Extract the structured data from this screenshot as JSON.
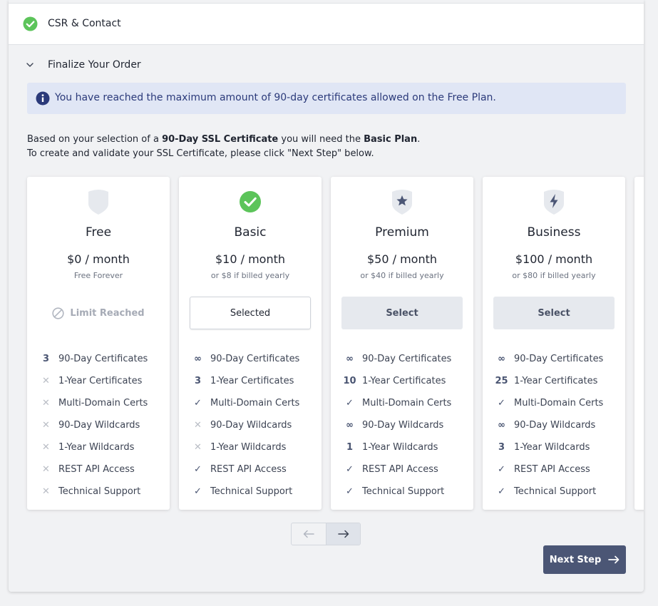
{
  "steps": {
    "csr_label": "CSR & Contact",
    "finalize_label": "Finalize Your Order"
  },
  "alert": {
    "text": "You have reached the maximum amount of 90-day certificates allowed on the Free Plan."
  },
  "info": {
    "line1_pre": "Based on your selection of a ",
    "line1_cert": "90-Day SSL Certificate",
    "line1_mid": " you will need the ",
    "line1_plan": "Basic Plan",
    "line1_post": ".",
    "line2": "To create and validate your SSL Certificate, please click \"Next Step\" below."
  },
  "plans": [
    {
      "name": "Free",
      "price": "$0 / month",
      "note": "Free Forever",
      "button": "Limit Reached",
      "features": [
        {
          "mark": "3",
          "label": "90-Day Certificates"
        },
        {
          "mark": "✕",
          "label": "1-Year Certificates"
        },
        {
          "mark": "✕",
          "label": "Multi-Domain Certs"
        },
        {
          "mark": "✕",
          "label": "90-Day Wildcards"
        },
        {
          "mark": "✕",
          "label": "1-Year Wildcards"
        },
        {
          "mark": "✕",
          "label": "REST API Access"
        },
        {
          "mark": "✕",
          "label": "Technical Support"
        }
      ]
    },
    {
      "name": "Basic",
      "price": "$10 / month",
      "note": "or $8 if billed yearly",
      "button": "Selected",
      "features": [
        {
          "mark": "∞",
          "label": "90-Day Certificates"
        },
        {
          "mark": "3",
          "label": "1-Year Certificates"
        },
        {
          "mark": "✓",
          "label": "Multi-Domain Certs"
        },
        {
          "mark": "✕",
          "label": "90-Day Wildcards"
        },
        {
          "mark": "✕",
          "label": "1-Year Wildcards"
        },
        {
          "mark": "✓",
          "label": "REST API Access"
        },
        {
          "mark": "✓",
          "label": "Technical Support"
        }
      ]
    },
    {
      "name": "Premium",
      "price": "$50 / month",
      "note": "or $40 if billed yearly",
      "button": "Select",
      "features": [
        {
          "mark": "∞",
          "label": "90-Day Certificates"
        },
        {
          "mark": "10",
          "label": "1-Year Certificates"
        },
        {
          "mark": "✓",
          "label": "Multi-Domain Certs"
        },
        {
          "mark": "∞",
          "label": "90-Day Wildcards"
        },
        {
          "mark": "1",
          "label": "1-Year Wildcards"
        },
        {
          "mark": "✓",
          "label": "REST API Access"
        },
        {
          "mark": "✓",
          "label": "Technical Support"
        }
      ]
    },
    {
      "name": "Business",
      "price": "$100 / month",
      "note": "or $80 if billed yearly",
      "button": "Select",
      "features": [
        {
          "mark": "∞",
          "label": "90-Day Certificates"
        },
        {
          "mark": "25",
          "label": "1-Year Certificates"
        },
        {
          "mark": "✓",
          "label": "Multi-Domain Certs"
        },
        {
          "mark": "∞",
          "label": "90-Day Wildcards"
        },
        {
          "mark": "3",
          "label": "1-Year Wildcards"
        },
        {
          "mark": "✓",
          "label": "REST API Access"
        },
        {
          "mark": "✓",
          "label": "Technical Support"
        }
      ]
    }
  ],
  "footer": {
    "next_step_label": "Next Step"
  },
  "icons": {
    "csr_status": "check-circle-icon",
    "free": "shield-icon",
    "basic": "check-circle-icon",
    "premium": "shield-star-icon",
    "business": "shield-bolt-icon"
  },
  "colors": {
    "success": "#5cc45a",
    "primary": "#4b5675",
    "alert_bg": "#e0e6f5",
    "alert_text": "#2b3a7a"
  }
}
